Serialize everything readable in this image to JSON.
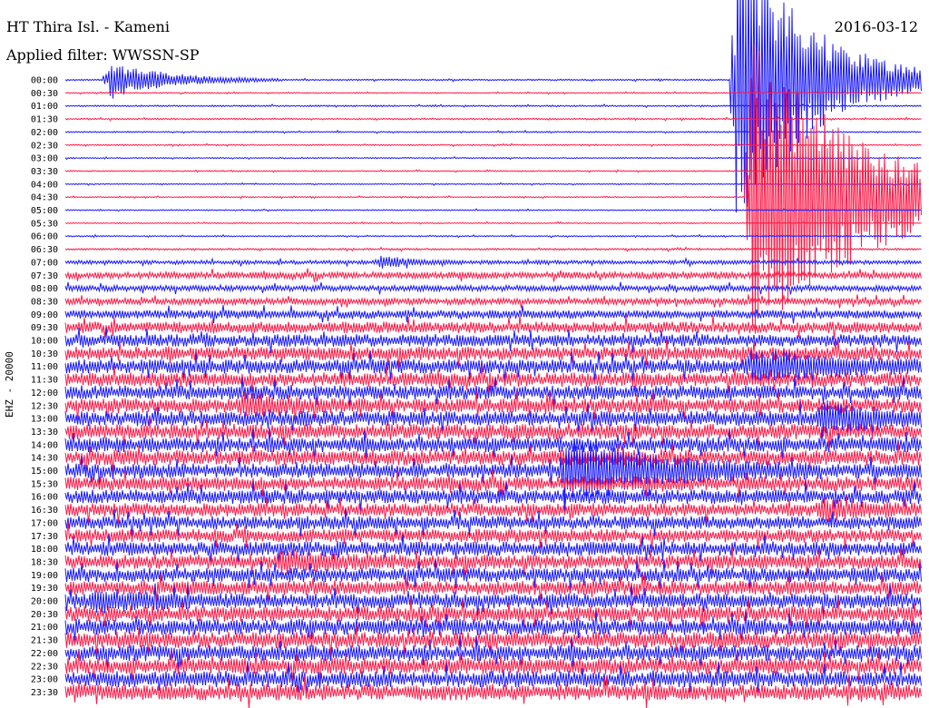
{
  "header": {
    "station": "HT Thira Isl. - Kameni",
    "filter": "Applied filter: WWSSN-SP",
    "date": "2016-03-12"
  },
  "chart_data": {
    "type": "line",
    "title": "HT Thira Isl. - Kameni",
    "subtitle": "Applied filter: WWSSN-SP",
    "date": "2016-03-12",
    "ylabel": "EHZ - 20000",
    "row_labels": [
      "00:00",
      "00:30",
      "01:00",
      "01:30",
      "02:00",
      "02:30",
      "03:00",
      "03:30",
      "04:00",
      "04:30",
      "05:00",
      "05:30",
      "06:00",
      "06:30",
      "07:00",
      "07:30",
      "08:00",
      "08:30",
      "09:00",
      "09:30",
      "10:00",
      "10:30",
      "11:00",
      "11:30",
      "12:00",
      "12:30",
      "13:00",
      "13:30",
      "14:00",
      "14:30",
      "15:00",
      "15:30",
      "16:00",
      "16:30",
      "17:00",
      "17:30",
      "18:00",
      "18:30",
      "19:00",
      "19:30",
      "20:00",
      "20:30",
      "21:00",
      "21:30",
      "22:00",
      "22:30",
      "23:00",
      "23:30"
    ],
    "trace_colors": [
      "#1a1aff",
      "#ff1a47"
    ],
    "noise_level": [
      0.08,
      0.06,
      0.08,
      0.08,
      0.07,
      0.07,
      0.06,
      0.06,
      0.06,
      0.06,
      0.06,
      0.06,
      0.07,
      0.1,
      0.2,
      0.35,
      0.3,
      0.35,
      0.45,
      0.6,
      0.65,
      0.7,
      0.75,
      0.75,
      0.75,
      0.75,
      0.8,
      0.8,
      0.8,
      0.8,
      0.75,
      0.75,
      0.75,
      0.7,
      0.7,
      0.7,
      0.75,
      0.75,
      0.75,
      0.75,
      0.8,
      0.8,
      0.85,
      0.85,
      0.85,
      0.85,
      0.85,
      0.85
    ],
    "events": [
      {
        "row": 0,
        "minute": 1.5,
        "amplitude": 3.0,
        "duration_min": 2.0
      },
      {
        "row": 0,
        "minute": 23.5,
        "amplitude": 25,
        "duration_min": 2.5
      },
      {
        "row": 2,
        "minute": 30.5,
        "amplitude": 1.5,
        "duration_min": 1.2
      },
      {
        "row": 9,
        "minute": 24,
        "amplitude": 25,
        "duration_min": 4.0
      },
      {
        "row": 25,
        "minute": 6.2,
        "amplitude": 1.3,
        "duration_min": 1.5
      },
      {
        "row": 26,
        "minute": 26.5,
        "amplitude": 2.0,
        "duration_min": 2.0
      },
      {
        "row": 30,
        "minute": 17.5,
        "amplitude": 5.0,
        "duration_min": 3.0
      },
      {
        "row": 22,
        "minute": 24,
        "amplitude": 2.0,
        "duration_min": 3.0
      },
      {
        "row": 14,
        "minute": 11,
        "amplitude": 1.0,
        "duration_min": 1.0
      },
      {
        "row": 33,
        "minute": 26.5,
        "amplitude": 1.3,
        "duration_min": 1.5
      },
      {
        "row": 40,
        "minute": 1.0,
        "amplitude": 1.2,
        "duration_min": 1.5
      },
      {
        "row": 37,
        "minute": 7.5,
        "amplitude": 1.4,
        "duration_min": 1.5
      }
    ]
  }
}
